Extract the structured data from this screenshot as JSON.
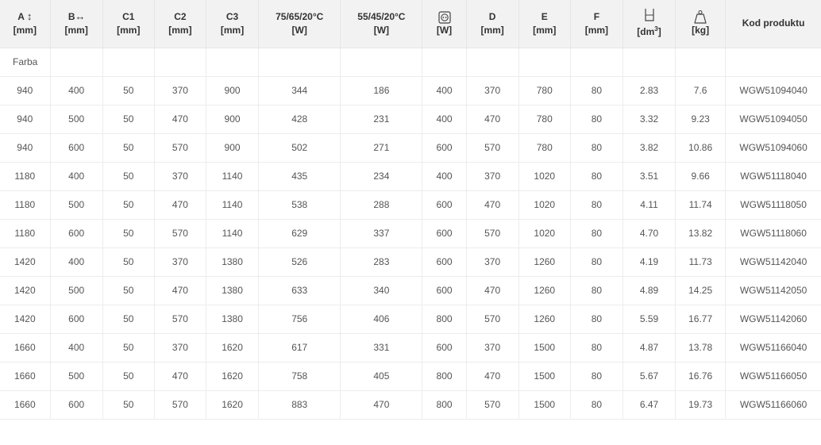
{
  "headers": [
    {
      "key": "A",
      "label": "A",
      "unit": "[mm]",
      "icon": "vertical-double-arrow-icon"
    },
    {
      "key": "B",
      "label": "B",
      "unit": "[mm]",
      "icon": "horizontal-double-arrow-icon"
    },
    {
      "key": "C1",
      "label": "C1",
      "unit": "[mm]"
    },
    {
      "key": "C2",
      "label": "C2",
      "unit": "[mm]"
    },
    {
      "key": "C3",
      "label": "C3",
      "unit": "[mm]"
    },
    {
      "key": "P75",
      "label": "75/65/20°C",
      "unit": "[W]"
    },
    {
      "key": "P55",
      "label": "55/45/20°C",
      "unit": "[W]"
    },
    {
      "key": "PE",
      "label": "",
      "unit": "[W]",
      "icon": "power-socket-icon"
    },
    {
      "key": "D",
      "label": "D",
      "unit": "[mm]"
    },
    {
      "key": "E",
      "label": "E",
      "unit": "[mm]"
    },
    {
      "key": "F",
      "label": "F",
      "unit": "[mm]"
    },
    {
      "key": "V",
      "label": "",
      "unit": "[dm3]",
      "icon": "water-volume-icon"
    },
    {
      "key": "W",
      "label": "",
      "unit": "[kg]",
      "icon": "weight-icon"
    },
    {
      "key": "KOD",
      "label": "Kod produktu",
      "unit": ""
    }
  ],
  "group_label": "Farba",
  "rows": [
    [
      "940",
      "400",
      "50",
      "370",
      "900",
      "344",
      "186",
      "400",
      "370",
      "780",
      "80",
      "2.83",
      "7.6",
      "WGW51094040"
    ],
    [
      "940",
      "500",
      "50",
      "470",
      "900",
      "428",
      "231",
      "400",
      "470",
      "780",
      "80",
      "3.32",
      "9.23",
      "WGW51094050"
    ],
    [
      "940",
      "600",
      "50",
      "570",
      "900",
      "502",
      "271",
      "600",
      "570",
      "780",
      "80",
      "3.82",
      "10.86",
      "WGW51094060"
    ],
    [
      "1180",
      "400",
      "50",
      "370",
      "1140",
      "435",
      "234",
      "400",
      "370",
      "1020",
      "80",
      "3.51",
      "9.66",
      "WGW51118040"
    ],
    [
      "1180",
      "500",
      "50",
      "470",
      "1140",
      "538",
      "288",
      "600",
      "470",
      "1020",
      "80",
      "4.11",
      "11.74",
      "WGW51118050"
    ],
    [
      "1180",
      "600",
      "50",
      "570",
      "1140",
      "629",
      "337",
      "600",
      "570",
      "1020",
      "80",
      "4.70",
      "13.82",
      "WGW51118060"
    ],
    [
      "1420",
      "400",
      "50",
      "370",
      "1380",
      "526",
      "283",
      "600",
      "370",
      "1260",
      "80",
      "4.19",
      "11.73",
      "WGW51142040"
    ],
    [
      "1420",
      "500",
      "50",
      "470",
      "1380",
      "633",
      "340",
      "600",
      "470",
      "1260",
      "80",
      "4.89",
      "14.25",
      "WGW51142050"
    ],
    [
      "1420",
      "600",
      "50",
      "570",
      "1380",
      "756",
      "406",
      "800",
      "570",
      "1260",
      "80",
      "5.59",
      "16.77",
      "WGW51142060"
    ],
    [
      "1660",
      "400",
      "50",
      "370",
      "1620",
      "617",
      "331",
      "600",
      "370",
      "1500",
      "80",
      "4.87",
      "13.78",
      "WGW51166040"
    ],
    [
      "1660",
      "500",
      "50",
      "470",
      "1620",
      "758",
      "405",
      "800",
      "470",
      "1500",
      "80",
      "5.67",
      "16.76",
      "WGW51166050"
    ],
    [
      "1660",
      "600",
      "50",
      "570",
      "1620",
      "883",
      "470",
      "800",
      "570",
      "1500",
      "80",
      "6.47",
      "19.73",
      "WGW51166060"
    ]
  ]
}
